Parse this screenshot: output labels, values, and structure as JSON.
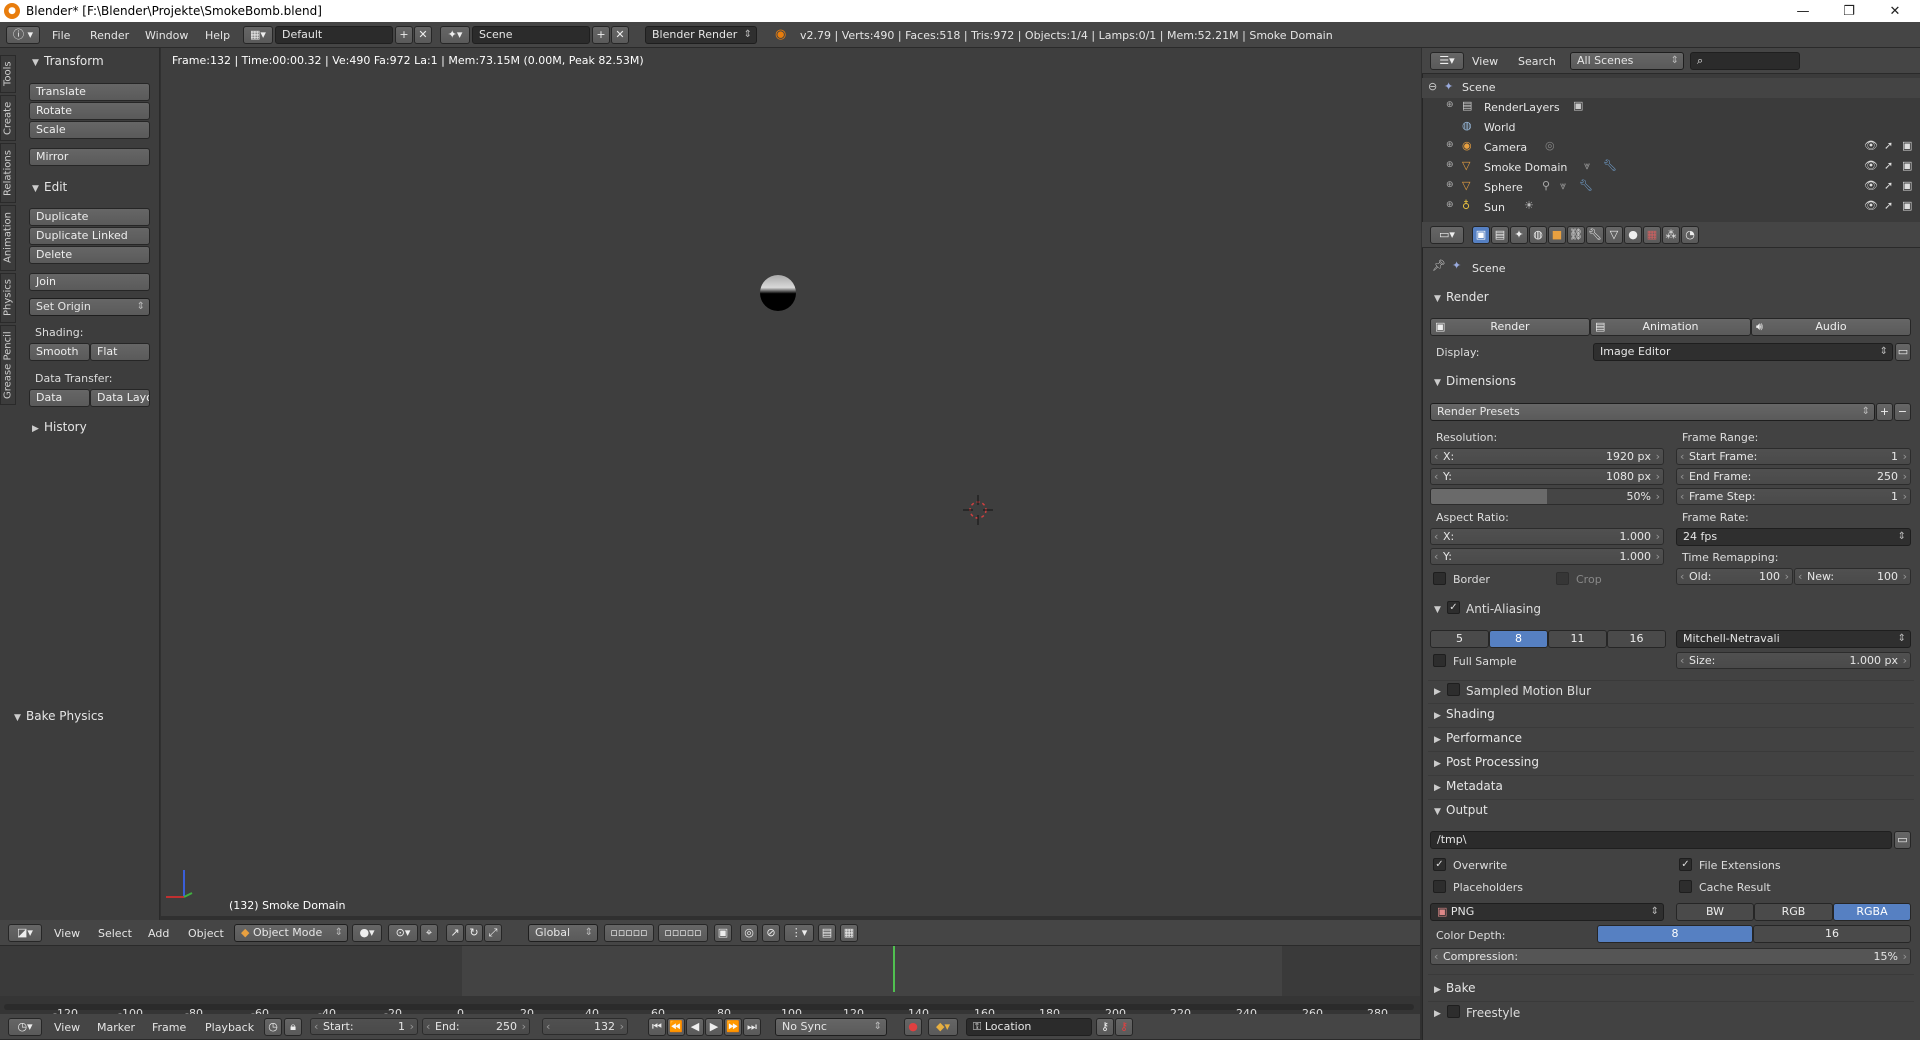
{
  "window": {
    "title": "Blender* [F:\\Blender\\Projekte\\SmokeBomb.blend]",
    "minimize": "—",
    "maximize": "❐",
    "close": "✕"
  },
  "info_header": {
    "menus": [
      "File",
      "Render",
      "Window",
      "Help"
    ],
    "screen_layout": "Default",
    "scene": "Scene",
    "engine": "Blender Render",
    "stats": "v2.79 | Verts:490 | Faces:518 | Tris:972 | Objects:1/4 | Lamps:0/1 | Mem:52.21M | Smoke Domain"
  },
  "toolshelf": {
    "tabs": [
      "Tools",
      "Create",
      "Relations",
      "Animation",
      "Physics",
      "Grease Pencil"
    ],
    "transform": {
      "title": "Transform",
      "buttons": [
        "Translate",
        "Rotate",
        "Scale",
        "Mirror"
      ]
    },
    "edit": {
      "title": "Edit",
      "buttons": [
        "Duplicate",
        "Duplicate Linked",
        "Delete",
        "Join"
      ],
      "set_origin": "Set Origin",
      "shading_label": "Shading:",
      "shading": [
        "Smooth",
        "Flat"
      ],
      "data_transfer_label": "Data Transfer:",
      "data_transfer": [
        "Data",
        "Data Layo"
      ]
    },
    "history": "History",
    "bake_physics": "Bake Physics"
  },
  "viewport": {
    "info": "Frame:132 | Time:00:00.32 | Ve:490 Fa:972 La:1 | Mem:73.15M (0.00M, Peak 82.53M)",
    "object_label": "(132) Smoke Domain",
    "header": {
      "menus": [
        "View",
        "Select",
        "Add",
        "Object"
      ],
      "mode": "Object Mode",
      "orientation": "Global"
    }
  },
  "timeline": {
    "ruler": [
      "-120",
      "-100",
      "-80",
      "-60",
      "-40",
      "-20",
      "0",
      "20",
      "40",
      "60",
      "80",
      "100",
      "120",
      "140",
      "160",
      "180",
      "200",
      "220",
      "240",
      "260",
      "280"
    ],
    "current_frame": 132,
    "header": {
      "menus": [
        "View",
        "Marker",
        "Frame",
        "Playback"
      ],
      "start_label": "Start:",
      "start": "1",
      "end_label": "End:",
      "end": "250",
      "current": "132",
      "sync": "No Sync",
      "keying_set": "Location"
    }
  },
  "outliner": {
    "header": {
      "view": "View",
      "search": "Search",
      "filter": "All Scenes"
    },
    "items": [
      {
        "label": "Scene",
        "icon": "scene-icon",
        "depth": 0
      },
      {
        "label": "RenderLayers",
        "icon": "renderlayers-icon",
        "depth": 1
      },
      {
        "label": "World",
        "icon": "world-icon",
        "depth": 1
      },
      {
        "label": "Camera",
        "icon": "camera-icon",
        "depth": 1
      },
      {
        "label": "Smoke Domain",
        "icon": "mesh-icon",
        "depth": 1
      },
      {
        "label": "Sphere",
        "icon": "mesh-icon",
        "depth": 1
      },
      {
        "label": "Sun",
        "icon": "lamp-icon",
        "depth": 1
      }
    ]
  },
  "properties": {
    "context": "Scene",
    "render": {
      "title": "Render",
      "buttons": [
        "Render",
        "Animation",
        "Audio"
      ],
      "display_label": "Display:",
      "display": "Image Editor"
    },
    "dimensions": {
      "title": "Dimensions",
      "presets": "Render Presets",
      "resolution_label": "Resolution:",
      "res_x_label": "X:",
      "res_x": "1920 px",
      "res_y_label": "Y:",
      "res_y": "1080 px",
      "res_pct": "50%",
      "res_pct_value": 50,
      "aspect_label": "Aspect Ratio:",
      "asp_x_label": "X:",
      "asp_x": "1.000",
      "asp_y_label": "Y:",
      "asp_y": "1.000",
      "border": "Border",
      "crop": "Crop",
      "frame_range_label": "Frame Range:",
      "start_label": "Start Frame:",
      "start": "1",
      "end_label": "End Frame:",
      "end": "250",
      "step_label": "Frame Step:",
      "step": "1",
      "frame_rate_label": "Frame Rate:",
      "frame_rate": "24 fps",
      "time_remap_label": "Time Remapping:",
      "old_label": "Old:",
      "old": "100",
      "new_label": "New:",
      "new": "100"
    },
    "anti_aliasing": {
      "title": "Anti-Aliasing",
      "samples": [
        "5",
        "8",
        "11",
        "16"
      ],
      "filter": "Mitchell-Netravali",
      "full_sample": "Full Sample",
      "size_label": "Size:",
      "size": "1.000 px"
    },
    "collapsed": [
      "Sampled Motion Blur",
      "Shading",
      "Performance",
      "Post Processing",
      "Metadata"
    ],
    "output": {
      "title": "Output",
      "path": "/tmp\\",
      "overwrite": "Overwrite",
      "file_extensions": "File Extensions",
      "placeholders": "Placeholders",
      "cache_result": "Cache Result",
      "format": "PNG",
      "color_modes": [
        "BW",
        "RGB",
        "RGBA"
      ],
      "color_depth_label": "Color Depth:",
      "color_depths": [
        "8",
        "16"
      ],
      "compression_label": "Compression:",
      "compression": "15%"
    },
    "bake": "Bake",
    "freestyle": "Freestyle"
  }
}
